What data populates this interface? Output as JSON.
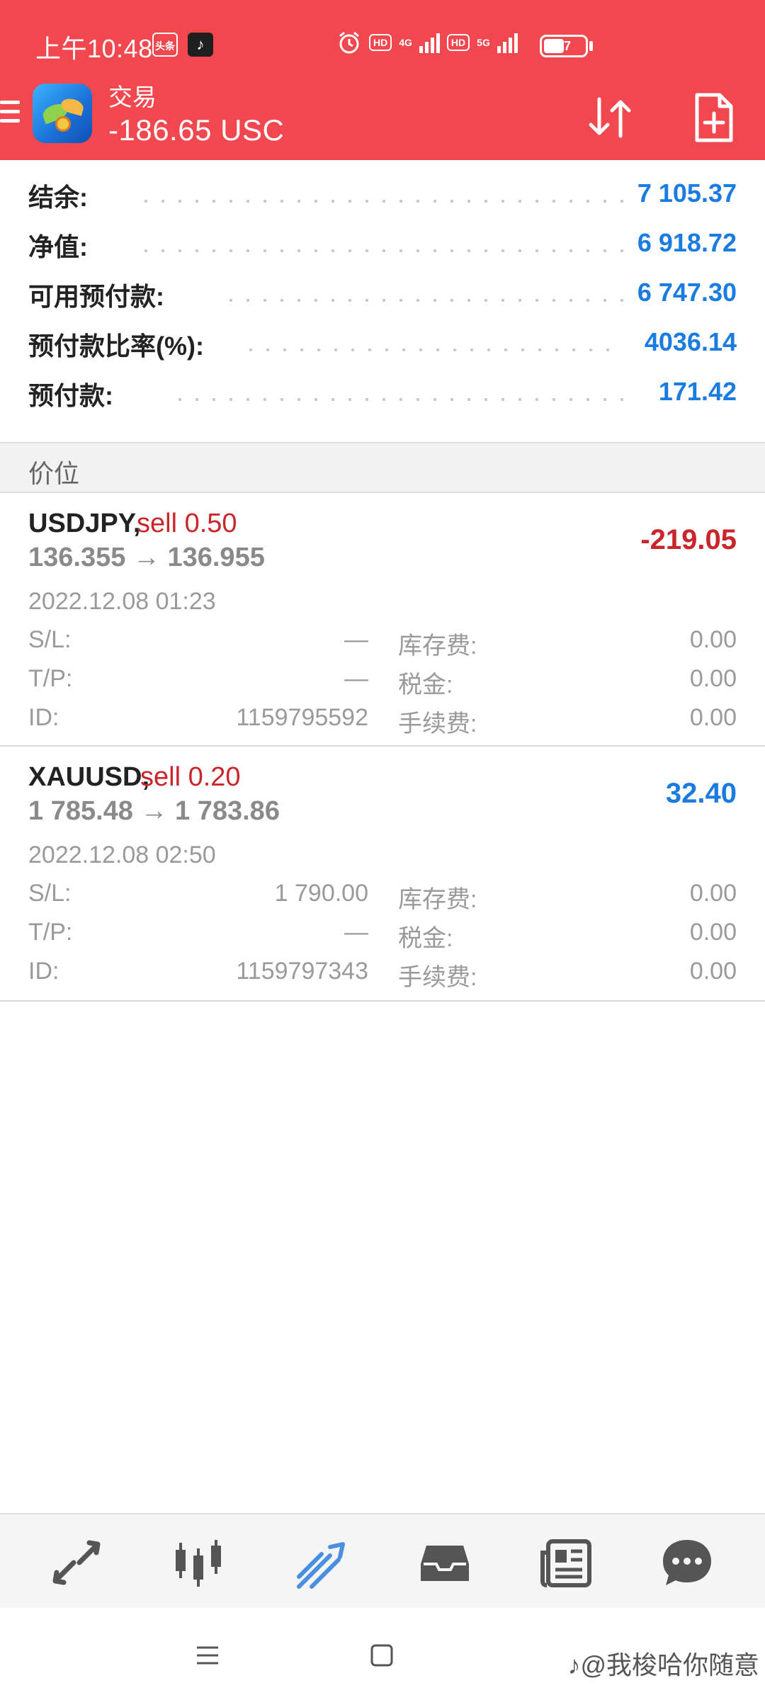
{
  "status_bar": {
    "time": "上午10:48",
    "toutiao_badge": "头条",
    "tiktok_badge": "♪",
    "hd1": "HD",
    "net1": "4G",
    "hd2": "HD",
    "net2": "5G",
    "battery": "47"
  },
  "header": {
    "title": "交易",
    "balance_summary": "-186.65 USC",
    "icons": [
      "menu-icon",
      "metatrader-logo",
      "sort-icon",
      "new-order-icon"
    ],
    "color": "#f1474f"
  },
  "summary": [
    {
      "label": "结余:",
      "value": "7 105.37"
    },
    {
      "label": "净值:",
      "value": "6 918.72"
    },
    {
      "label": "可用预付款:",
      "value": "6 747.30"
    },
    {
      "label": "预付款比率(%):",
      "value": "4036.14"
    },
    {
      "label": "预付款:",
      "value": "171.42"
    }
  ],
  "section": {
    "title": "价位"
  },
  "positions": [
    {
      "symbol": "USDJPY,",
      "side": "sell 0.50",
      "prices": "136.355 → 136.955",
      "profit": "-219.05",
      "time": "2022.12.08 01:23",
      "sl_label": "S/L:",
      "sl": "—",
      "tp_label": "T/P:",
      "tp": "—",
      "id_label": "ID:",
      "id": "1159795592",
      "swap_label": "库存费:",
      "swap": "0.00",
      "tax_label": "税金:",
      "tax": "0.00",
      "fee_label": "手续费:",
      "fee": "0.00"
    },
    {
      "symbol": "XAUUSD,",
      "side": "sell 0.20",
      "prices": "1 785.48 → 1 783.86",
      "profit": "32.40",
      "time": "2022.12.08 02:50",
      "sl_label": "S/L:",
      "sl": "1 790.00",
      "tp_label": "T/P:",
      "tp": "—",
      "id_label": "ID:",
      "id": "1159797343",
      "swap_label": "库存费:",
      "swap": "0.00",
      "tax_label": "税金:",
      "tax": "0.00",
      "fee_label": "手续费:",
      "fee": "0.00"
    }
  ],
  "bottom_nav": [
    "quotes-icon",
    "chart-icon",
    "trade-icon",
    "history-icon",
    "news-icon",
    "chat-icon"
  ],
  "active_color": "#4a90e2",
  "system_nav": {
    "watermark": "♪@我梭哈你随意"
  }
}
